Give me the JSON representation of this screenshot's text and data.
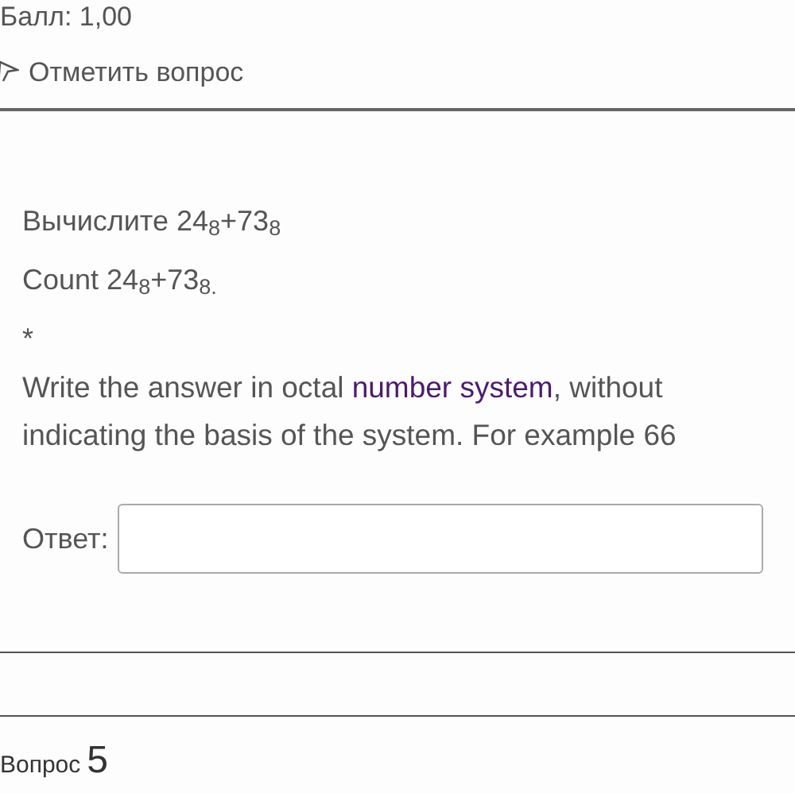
{
  "header": {
    "score": "Балл: 1,00",
    "flag_label": "Отметить вопрос"
  },
  "question": {
    "lines": [
      "Вычислите 24$_{8}$+73$_{8}$",
      "Count 24$_{8}$+73$_{8.}$",
      "*"
    ],
    "instruction": {
      "before": "Write the answer in octal ",
      "link": "number system",
      "after": ", without indicating the basis of the system. For example 66"
    },
    "answer_label": "Ответ:"
  },
  "next_question": {
    "label": "Вопрос",
    "number": "5"
  }
}
